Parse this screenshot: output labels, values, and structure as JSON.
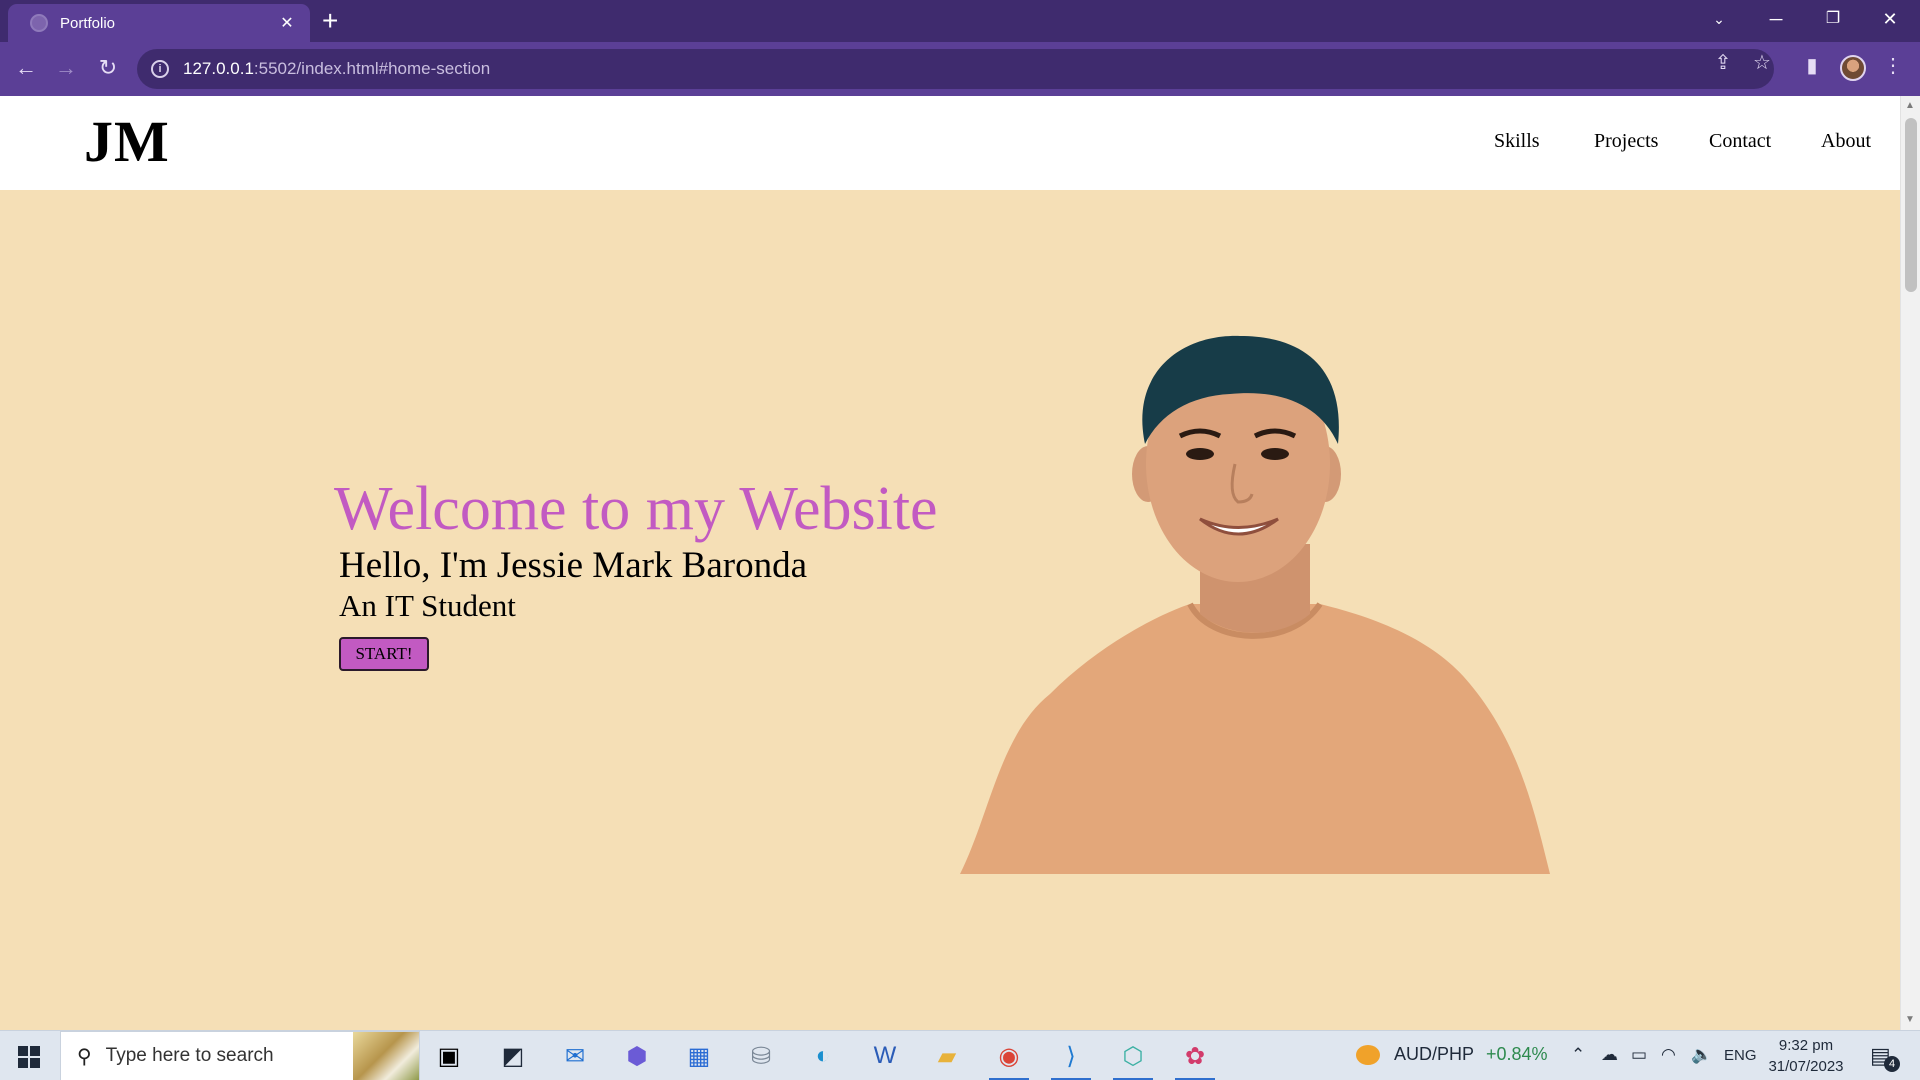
{
  "browser": {
    "tab_title": "Portfolio",
    "url_host": "127.0.0.1",
    "url_rest": ":5502/index.html#home-section"
  },
  "site": {
    "logo": "JM",
    "nav": [
      "Skills",
      "Projects",
      "Contact",
      "About"
    ]
  },
  "hero": {
    "heading": "Welcome to my Website",
    "name": "Hello, I'm Jessie Mark Baronda",
    "role": "An IT Student",
    "button": "START!"
  },
  "taskbar": {
    "search_placeholder": "Type here to search",
    "widget_pair": "AUD/PHP",
    "widget_change": "+0.84%",
    "language": "ENG",
    "time": "9:32 pm",
    "date": "31/07/2023",
    "notifications": "4"
  },
  "colors": {
    "chrome_purple": "#5b3f96",
    "page_bg": "#f5dfb6",
    "accent_pink": "#c25ac2"
  }
}
